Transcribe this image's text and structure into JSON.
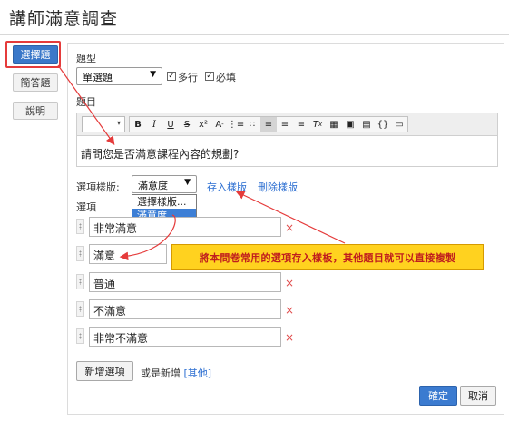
{
  "page_title": "講師滿意調查",
  "sidebar": {
    "items": [
      {
        "label": "選擇題"
      },
      {
        "label": "簡答題"
      },
      {
        "label": "說明"
      }
    ]
  },
  "form": {
    "type_label": "題型",
    "type_value": "單選題",
    "multiline_label": "多行",
    "required_label": "必填",
    "question_label": "題目",
    "question_text": "請問您是否滿意課程內容的規劃?",
    "template_label": "選項樣版:",
    "template_value": "滿意度",
    "template_options": [
      "選擇樣版...",
      "滿意度"
    ],
    "save_template": "存入樣版",
    "delete_template": "刪除樣版",
    "options_label": "選項",
    "options": [
      "非常滿意",
      "滿意",
      "普通",
      "不滿意",
      "非常不滿意"
    ],
    "delete_mark": "×",
    "add_option": "新增選項",
    "or_add": "或是新增",
    "other_link": "[其他]",
    "confirm": "確定",
    "cancel": "取消"
  },
  "toolbar": {
    "buttons": [
      "B",
      "I",
      "U",
      "S",
      "x²",
      "A",
      "list-ol",
      "list-ul",
      "align-left",
      "align-center",
      "align-right",
      "clear-format",
      "table",
      "image",
      "save",
      "code",
      "folder"
    ]
  },
  "annotation": {
    "callout_text": "將本問卷常用的選項存入樣板，其他題目就可以直接複製"
  },
  "colors": {
    "accent": "#3a78c9",
    "highlight_red": "#e53b3b",
    "callout_yellow": "#ffd21f",
    "link_blue": "#2b6ed1"
  }
}
